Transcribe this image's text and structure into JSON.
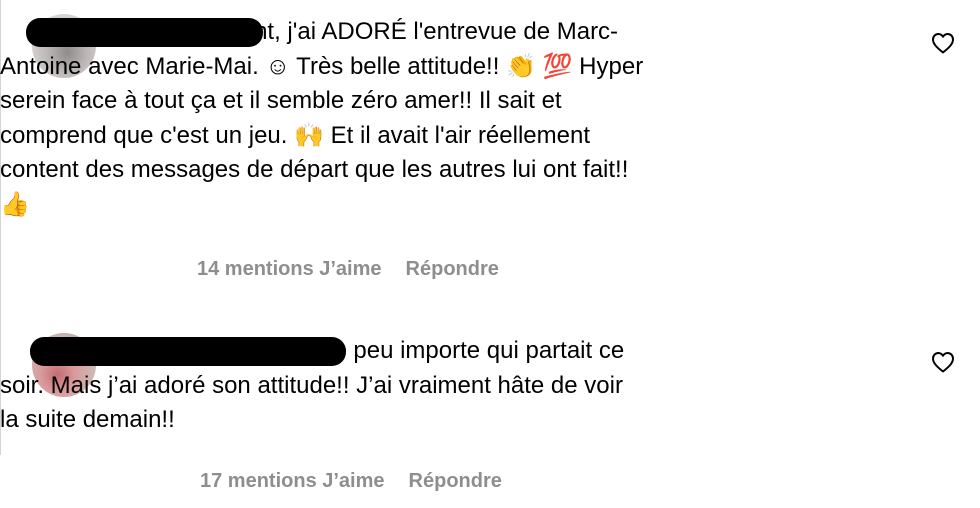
{
  "comments": [
    {
      "text": "Honnêtement, j'ai ADORÉ l'entrevue de Marc-\nAntoine avec Marie-Mai. ☺ Très belle attitude!! 👏 💯 Hyper\nserein face à tout ça et il semble zéro amer!! Il sait et\ncomprend que c'est un jeu. 🙌 Et il avait l'air réellement\ncontent des messages de départ que les autres lui ont fait!!\n👍",
      "likes_label": "14 mentions J’aime",
      "reply_label": "Répondre",
      "like_icon": "heart-outline-icon"
    },
    {
      "text": "C’était triste peu importe qui partait ce\nsoir. Mais j’ai adoré son attitude!! J’ai vraiment hâte de voir\nla suite demain!!",
      "likes_label": "17 mentions J’aime",
      "reply_label": "Répondre",
      "like_icon": "heart-outline-icon"
    }
  ],
  "colors": {
    "text": "#000000",
    "meta": "#8e8e8e",
    "redaction": "#000000",
    "divider": "#d4d4d4"
  }
}
